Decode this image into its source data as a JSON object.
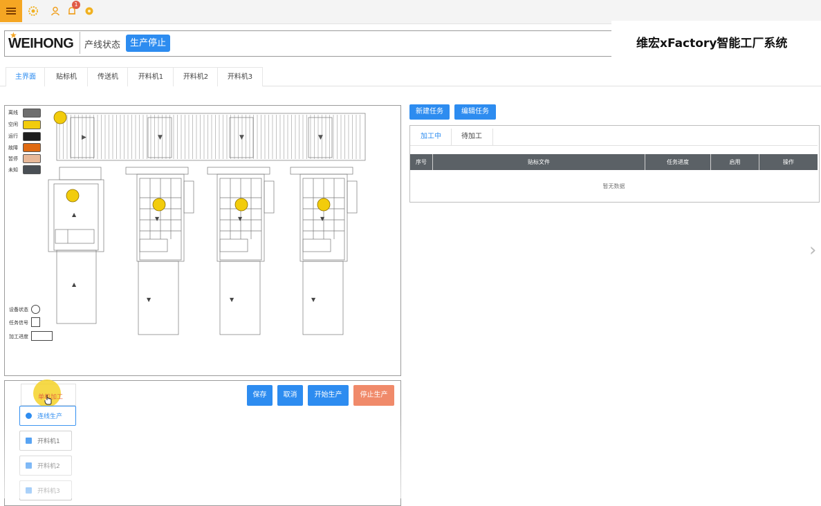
{
  "topbar": {
    "icons": [
      "menu-icon",
      "dashboard-icon",
      "user-icon",
      "bell-icon",
      "settings-icon"
    ],
    "notification_count": "1"
  },
  "header": {
    "logo_text": "WEIHONG",
    "line_status_label": "产线状态",
    "status_badge": "生产停止",
    "app_title": "维宏xFactory智能工厂系统"
  },
  "tabs": [
    {
      "label": "主界面"
    },
    {
      "label": "贴标机"
    },
    {
      "label": "传送机"
    },
    {
      "label": "开料机1"
    },
    {
      "label": "开料机2"
    },
    {
      "label": "开料机3"
    }
  ],
  "legend": {
    "items": [
      {
        "label": "离线",
        "color": "#6e6e6e"
      },
      {
        "label": "空闲",
        "color": "#f2cc0c"
      },
      {
        "label": "运行",
        "color": "#1e1e1e"
      },
      {
        "label": "故障",
        "color": "#e06a12"
      },
      {
        "label": "暂停",
        "color": "#e8b898"
      },
      {
        "label": "未知",
        "color": "#4a4f55"
      }
    ],
    "device_status_label": "设备状态",
    "task_signal_label": "任务信号",
    "process_progress_label": "加工进度"
  },
  "tasks": {
    "new_task_label": "新建任务",
    "edit_task_label": "编辑任务",
    "tab_processing": "加工中",
    "tab_pending": "待加工",
    "columns": [
      "序号",
      "贴标文件",
      "任务进度",
      "启用",
      "操作"
    ],
    "empty_text": "暂无数据"
  },
  "controls": {
    "single_process_label": "单机加工",
    "continuous_label": "连线生产",
    "machine_options": [
      "开料机1",
      "开料机2",
      "开料机3"
    ],
    "save_label": "保存",
    "cancel_label": "取消",
    "start_label": "开始生产",
    "stop_label": "停止生产"
  },
  "colors": {
    "accent": "#2d8cf0",
    "stop": "#f08a6a",
    "table_header": "#5b6166",
    "idle_indicator": "#f2cc0c"
  }
}
